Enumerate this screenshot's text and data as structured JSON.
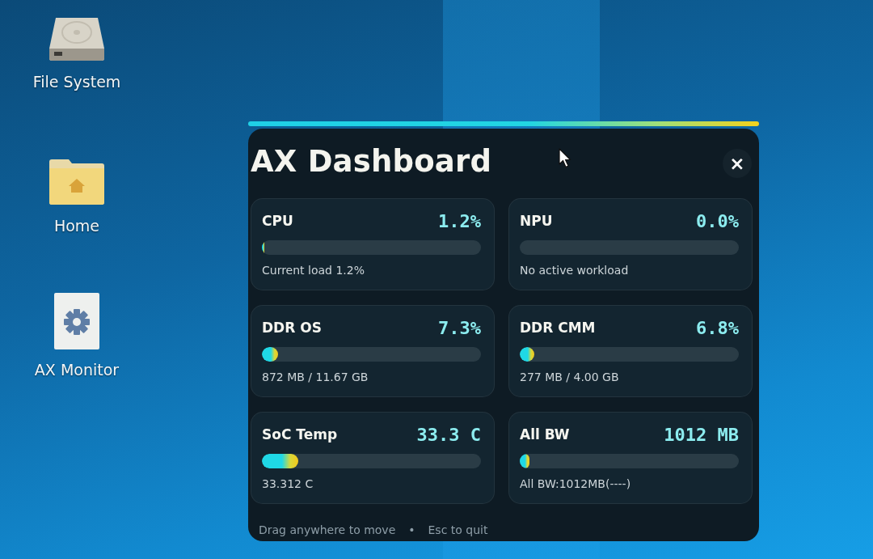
{
  "desktop_icons": [
    {
      "kind": "drive",
      "label": "File System"
    },
    {
      "kind": "home-folder",
      "label": "Home"
    },
    {
      "kind": "settings-app",
      "label": "AX Monitor"
    }
  ],
  "window": {
    "title": "AX Dashboard",
    "close": "×",
    "cards": [
      {
        "label": "CPU",
        "value": "1.2%",
        "level": 0.012,
        "detail": "Current load 1.2%"
      },
      {
        "label": "NPU",
        "value": "0.0%",
        "detail": "No active workload"
      },
      {
        "label": "DDR OS",
        "value": "7.3%",
        "level": 0.073,
        "detail": "872 MB / 11.67 GB"
      },
      {
        "label": "DDR CMM",
        "value": "6.8%",
        "level": 0.068,
        "detail": "277 MB / 4.00 GB"
      },
      {
        "label": "SoC Temp",
        "value": "33.3 C",
        "level": 0.165,
        "detail": "33.312 C"
      },
      {
        "label": "All BW",
        "value": "1012 MB",
        "level": 0.045,
        "detail": "All BW:1012MB(----)"
      }
    ],
    "footer": [
      "Drag anywhere to move",
      "•",
      "Esc to quit"
    ]
  }
}
